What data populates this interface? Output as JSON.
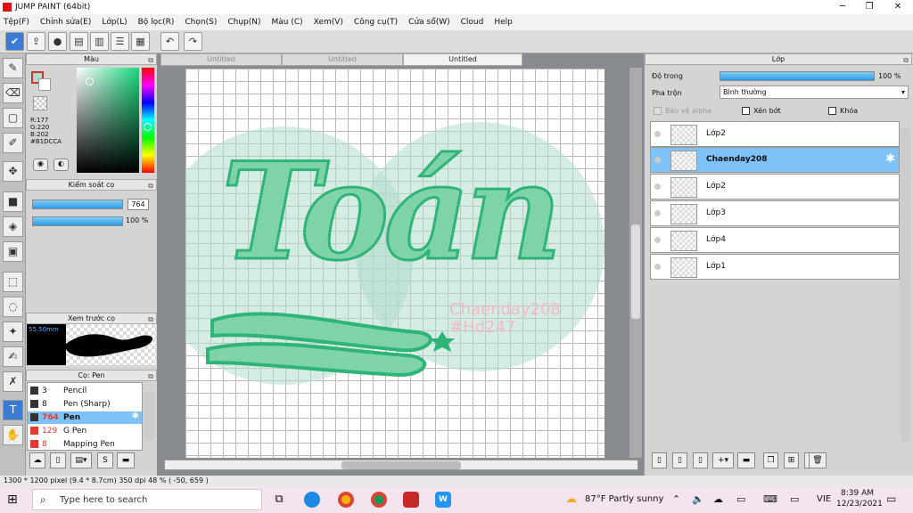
{
  "window": {
    "title": "JUMP PAINT (64bit)",
    "buttons": [
      "─",
      "❐",
      "✕"
    ]
  },
  "menu": [
    "Tệp(F)",
    "Chỉnh sửa(E)",
    "Lớp(L)",
    "Bộ lọc(R)",
    "Chọn(S)",
    "Chụp(N)",
    "Màu (C)",
    "Xem(V)",
    "Công cụ(T)",
    "Cửa sổ(W)",
    "Cloud",
    "Help"
  ],
  "color_panel": {
    "title": "Màu",
    "r": "R:177",
    "g": "G:220",
    "b": "B:202",
    "hex": "#B1DCCA",
    "current_color": "#B1DCCA"
  },
  "brush_control": {
    "title": "Kiểm soát cọ",
    "size": "764",
    "opacity": "100 %"
  },
  "preview": {
    "title": "Xem trước cọ",
    "size": "55.50mm"
  },
  "brush_list": {
    "title": "Cọ: Pen",
    "items": [
      {
        "size": "3",
        "name": "Pencil",
        "color": "#333333",
        "selected": false
      },
      {
        "size": "8",
        "name": "Pen (Sharp)",
        "color": "#333333",
        "selected": false
      },
      {
        "size": "764",
        "name": "Pen",
        "color": "#333333",
        "selected": true
      },
      {
        "size": "129",
        "name": "G Pen",
        "color": "#e53935",
        "selected": false
      },
      {
        "size": "8",
        "name": "Mapping Pen",
        "color": "#e53935",
        "selected": false
      }
    ]
  },
  "tabs": [
    "Untitled",
    "Untitled",
    "Untitled"
  ],
  "artwork": {
    "title": "Toán",
    "watermark1": "Chaenday208",
    "watermark2": "#Hd247"
  },
  "layer_panel": {
    "title": "Lớp",
    "opacity_label": "Độ trong",
    "opacity": "100 %",
    "blend_label": "Pha trộn",
    "blend": "Bình thường",
    "protect_alpha": "Bảo vệ alpha",
    "clip": "Xén bớt",
    "lock": "Khóa",
    "layers": [
      {
        "name": "Lớp2",
        "selected": false
      },
      {
        "name": "Chaenday208",
        "selected": true
      },
      {
        "name": "Lớp2",
        "selected": false
      },
      {
        "name": "Lớp3",
        "selected": false
      },
      {
        "name": "Lớp4",
        "selected": false
      },
      {
        "name": "Lớp1",
        "selected": false
      }
    ]
  },
  "status": {
    "size": "1300 * 1200 pixel",
    "physical": "(9.4 * 8.7cm)",
    "dpi": "350 dpi",
    "zoom": "48 %",
    "coords": "( -50, 659 )"
  },
  "taskbar": {
    "search": "Type here to search",
    "weather": "87°F  Partly sunny",
    "lang": "VIE",
    "time": "8:39 AM",
    "date": "12/23/2021"
  }
}
